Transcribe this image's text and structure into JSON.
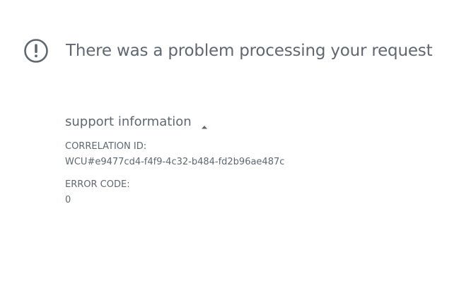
{
  "error": {
    "icon": "exclamation-circle-icon",
    "title": "There was a problem processing your request"
  },
  "support": {
    "heading": "support information",
    "toggle_icon": "caret-up-icon",
    "correlation_label": "CORRELATION ID:",
    "correlation_value": "WCU#e9477cd4-f4f9-4c32-b484-fd2b96ae487c",
    "error_code_label": "ERROR CODE:",
    "error_code_value": "0"
  },
  "colors": {
    "text": "#5f6770",
    "background": "#ffffff"
  }
}
